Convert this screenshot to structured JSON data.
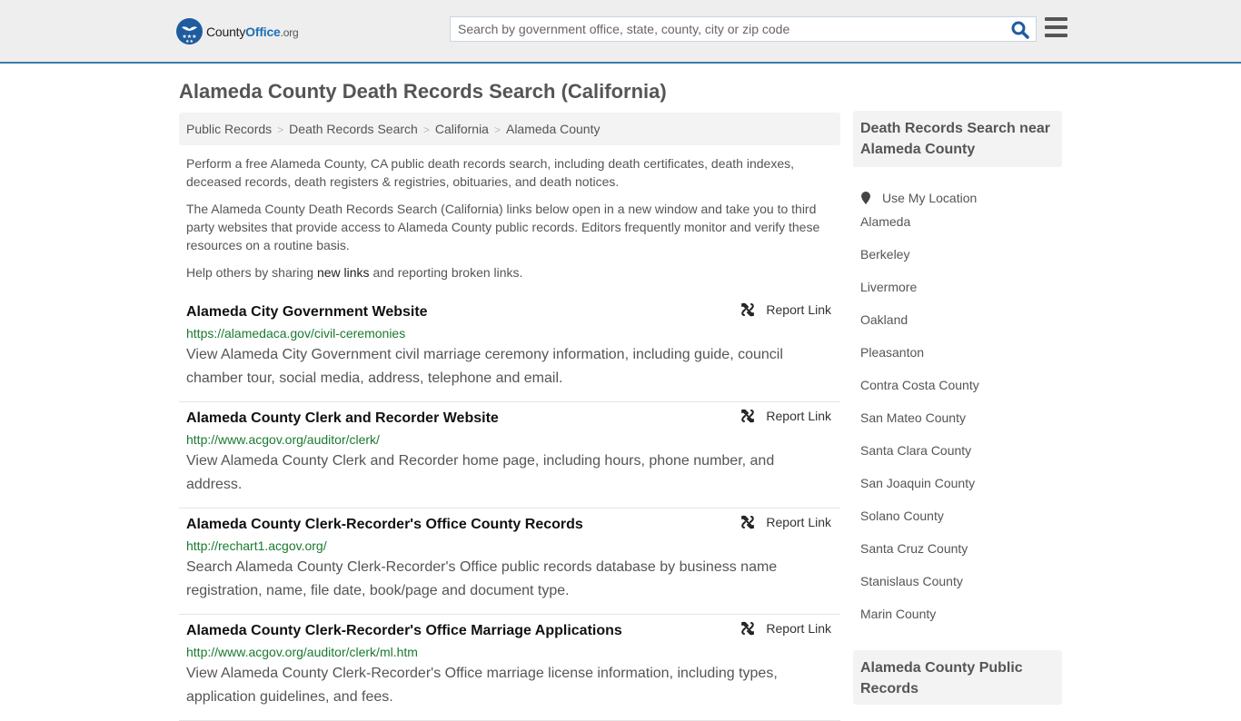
{
  "header": {
    "logo_main": "County",
    "logo_accent": "Office",
    "logo_tld": ".org",
    "search_placeholder": "Search by government office, state, county, city or zip code",
    "search_value": ""
  },
  "page": {
    "title": "Alameda County Death Records Search (California)"
  },
  "breadcrumb": [
    {
      "label": "Public Records"
    },
    {
      "label": "Death Records Search"
    },
    {
      "label": "California"
    },
    {
      "label": "Alameda County"
    }
  ],
  "intro": {
    "p1": "Perform a free Alameda County, CA public death records search, including death certificates, death indexes, deceased records, death registers & registries, obituaries, and death notices.",
    "p2": "The Alameda County Death Records Search (California) links below open in a new window and take you to third party websites that provide access to Alameda County public records. Editors frequently monitor and verify these resources on a routine basis.",
    "p3_before": "Help others by sharing ",
    "p3_link": "new links",
    "p3_after": " and reporting broken links."
  },
  "report_label": "Report Link",
  "results": [
    {
      "title": "Alameda City Government Website",
      "url": "https://alamedaca.gov/civil-ceremonies",
      "description": "View Alameda City Government civil marriage ceremony information, including guide, council chamber tour, social media, address, telephone and email."
    },
    {
      "title": "Alameda County Clerk and Recorder Website",
      "url": "http://www.acgov.org/auditor/clerk/",
      "description": "View Alameda County Clerk and Recorder home page, including hours, phone number, and address."
    },
    {
      "title": "Alameda County Clerk-Recorder's Office County Records",
      "url": "http://rechart1.acgov.org/",
      "description": "Search Alameda County Clerk-Recorder's Office public records database by business name registration, name, file date, book/page and document type."
    },
    {
      "title": "Alameda County Clerk-Recorder's Office Marriage Applications",
      "url": "http://www.acgov.org/auditor/clerk/ml.htm",
      "description": "View Alameda County Clerk-Recorder's Office marriage license information, including types, application guidelines, and fees."
    }
  ],
  "sidebar": {
    "heading": "Death Records Search near Alameda County",
    "use_location": "Use My Location",
    "links": [
      "Alameda",
      "Berkeley",
      "Livermore",
      "Oakland",
      "Pleasanton",
      "Contra Costa County",
      "San Mateo County",
      "Santa Clara County",
      "San Joaquin County",
      "Solano County",
      "Santa Cruz County",
      "Stanislaus County",
      "Marin County"
    ],
    "heading2": "Alameda County Public Records"
  }
}
